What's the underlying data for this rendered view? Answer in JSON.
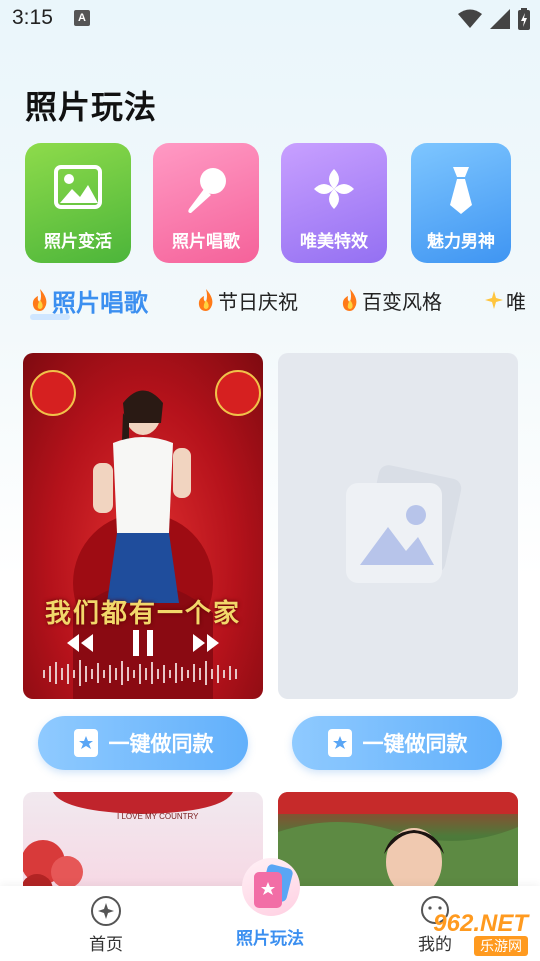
{
  "status": {
    "time": "3:15",
    "notification_icon": "A"
  },
  "page": {
    "title": "照片玩法"
  },
  "features": [
    {
      "label": "照片变活",
      "icon": "image-icon",
      "color": "#5cc040"
    },
    {
      "label": "照片唱歌",
      "icon": "microphone-icon",
      "color": "#f576a6"
    },
    {
      "label": "唯美特效",
      "icon": "flower-icon",
      "color": "#a47ff5"
    },
    {
      "label": "魅力男神",
      "icon": "tie-icon",
      "color": "#4d9ff3"
    }
  ],
  "tabs": [
    {
      "label": "照片唱歌",
      "active": true
    },
    {
      "label": "节日庆祝",
      "active": false
    },
    {
      "label": "百变风格",
      "active": false
    },
    {
      "label": "唯",
      "active": false
    }
  ],
  "cards": {
    "video_lyric": "我们都有一个家",
    "bottom_left_caption": "I LOVE MY COUNTRY"
  },
  "actions": {
    "make_same_left": "一键做同款",
    "make_same_right": "一键做同款"
  },
  "nav": {
    "home": "首页",
    "play": "照片玩法",
    "mine": "我的"
  },
  "watermark": {
    "brand": "962.NET",
    "sub": "乐游网"
  },
  "colors": {
    "accent": "#3b8ff0",
    "button": "#6fb7fc"
  }
}
